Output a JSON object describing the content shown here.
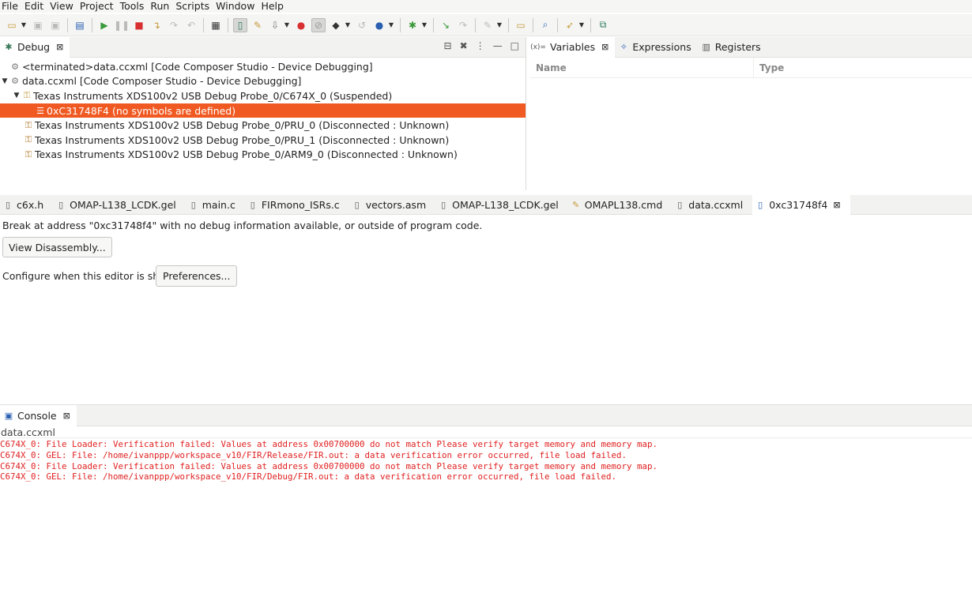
{
  "menubar": {
    "items": [
      "File",
      "Edit",
      "View",
      "Project",
      "Tools",
      "Run",
      "Scripts",
      "Window",
      "Help"
    ]
  },
  "toolbar": {
    "icons": [
      "new-icon",
      "dropdown-arrow",
      "save-icon",
      "save-all-icon",
      "terminal-icon",
      "resume-icon",
      "suspend-icon",
      "terminate-icon",
      "step-into-icon",
      "step-over-icon",
      "step-return-icon",
      "memory-browser-icon",
      "connect-target-icon",
      "restart-icon",
      "load-program-icon",
      "dropdown-arrow",
      "disable-breakpoints-icon",
      "skip-breakpoints-icon",
      "breakpoint-icon",
      "dropdown-arrow",
      "reset-icon",
      "build-icon",
      "dropdown-arrow",
      "debug-icon",
      "dropdown-arrow",
      "assembly-step-into-icon",
      "assembly-step-over-icon",
      "tools-icon",
      "dropdown-arrow",
      "open-folder-icon",
      "search-icon",
      "run-icon",
      "dropdown-arrow",
      "perspective-icon"
    ]
  },
  "debug_view": {
    "tab_label": "Debug",
    "tree": [
      {
        "label": "<terminated>data.ccxml [Code Composer Studio - Device Debugging]",
        "level": 0
      },
      {
        "label": "data.ccxml [Code Composer Studio - Device Debugging]",
        "level": 0
      },
      {
        "label": "Texas Instruments XDS100v2 USB Debug Probe_0/C674X_0 (Suspended)",
        "level": 1
      },
      {
        "label": "0xC31748F4  (no symbols are defined)",
        "level": 2
      },
      {
        "label": "Texas Instruments XDS100v2 USB Debug Probe_0/PRU_0 (Disconnected : Unknown)",
        "level": 1
      },
      {
        "label": "Texas Instruments XDS100v2 USB Debug Probe_0/PRU_1 (Disconnected : Unknown)",
        "level": 1
      },
      {
        "label": "Texas Instruments XDS100v2 USB Debug Probe_0/ARM9_0 (Disconnected : Unknown)",
        "level": 1
      }
    ]
  },
  "variables_view": {
    "tabs": [
      "Variables",
      "Expressions",
      "Registers"
    ],
    "columns": [
      "Name",
      "Type"
    ]
  },
  "editor": {
    "tabs": [
      "c6x.h",
      "OMAP-L138_LCDK.gel",
      "main.c",
      "FIRmono_ISRs.c",
      "vectors.asm",
      "OMAP-L138_LCDK.gel",
      "OMAPL138.cmd",
      "data.ccxml",
      "0xc31748f4"
    ],
    "message": "Break at address \"0xc31748f4\" with no debug information available, or outside of program code.",
    "view_disassembly_label": "View Disassembly...",
    "configure_text": "Configure when this editor is shown",
    "preferences_label": "Preferences..."
  },
  "console": {
    "tab_label": "Console",
    "source": "data.ccxml",
    "lines": [
      "C674X_0: File Loader: Verification failed: Values at address 0x00700000 do not match Please verify target memory and memory map.",
      "C674X_0: GEL: File: /home/ivanppp/workspace_v10/FIR/Release/FIR.out: a data verification error occurred, file load failed.",
      "C674X_0: File Loader: Verification failed: Values at address 0x00700000 do not match Please verify target memory and memory map.",
      "C674X_0: GEL: File: /home/ivanppp/workspace_v10/FIR/Debug/FIR.out: a data verification error occurred, file load failed."
    ],
    "error_color": "#e02020"
  },
  "colors": {
    "selection": "#f05a22",
    "panel_header": "#f2f2f1"
  }
}
